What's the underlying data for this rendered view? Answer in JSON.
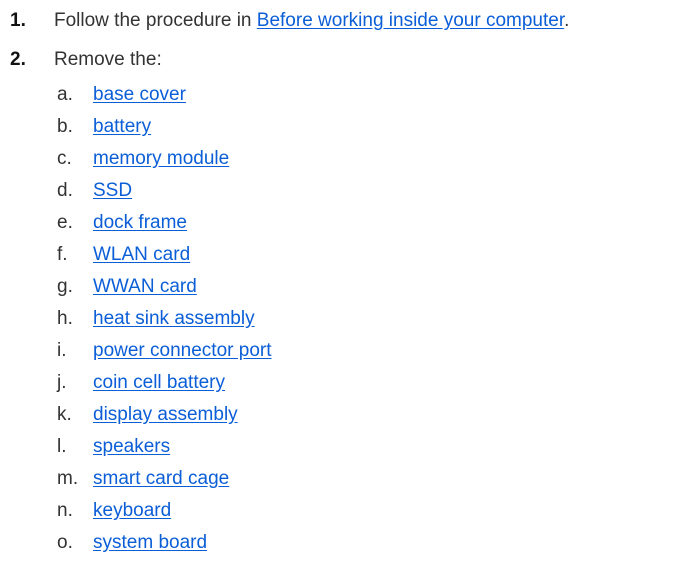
{
  "steps": [
    {
      "number": "1.",
      "text_before": "Follow the procedure in ",
      "link": "Before working inside your computer",
      "text_after": "."
    },
    {
      "number": "2.",
      "text": "Remove the:"
    }
  ],
  "remove_items": [
    {
      "letter": "a.",
      "label": "base cover"
    },
    {
      "letter": "b.",
      "label": "battery"
    },
    {
      "letter": "c.",
      "label": "memory module"
    },
    {
      "letter": "d.",
      "label": "SSD"
    },
    {
      "letter": "e.",
      "label": "dock frame"
    },
    {
      "letter": "f.",
      "label": "WLAN card"
    },
    {
      "letter": "g.",
      "label": "WWAN card"
    },
    {
      "letter": "h.",
      "label": "heat sink assembly"
    },
    {
      "letter": "i.",
      "label": "power connector port"
    },
    {
      "letter": "j.",
      "label": "coin cell battery"
    },
    {
      "letter": "k.",
      "label": "display assembly"
    },
    {
      "letter": "l.",
      "label": "speakers"
    },
    {
      "letter": "m.",
      "label": "smart card cage"
    },
    {
      "letter": "n.",
      "label": "keyboard"
    },
    {
      "letter": "o.",
      "label": "system board"
    }
  ],
  "colors": {
    "link": "#0b5ed7",
    "text": "#333333"
  }
}
